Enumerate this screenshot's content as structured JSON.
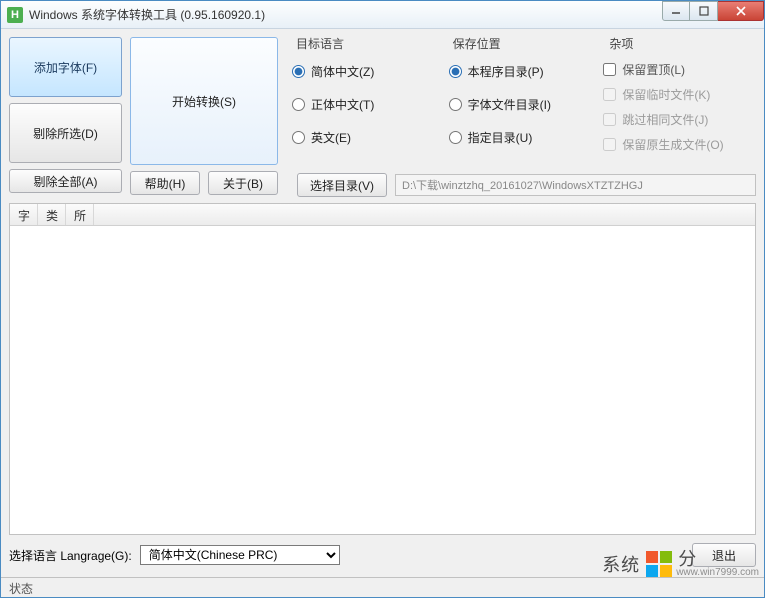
{
  "window": {
    "icon_letter": "H",
    "title": "Windows 系统字体转换工具 (0.95.160920.1)"
  },
  "left_buttons": {
    "add": "添加字体(F)",
    "remove_selected": "剔除所选(D)",
    "remove_all": "剔除全部(A)"
  },
  "main_button": "开始转换(S)",
  "help_button": "帮助(H)",
  "about_button": "关于(B)",
  "select_dir_button": "选择目录(V)",
  "path_value": "D:\\下载\\winztzhq_20161027\\WindowsXTZTZHGJ",
  "groups": {
    "target_lang": {
      "legend": "目标语言",
      "opts": [
        "简体中文(Z)",
        "正体中文(T)",
        "英文(E)"
      ],
      "selected": 0
    },
    "save_location": {
      "legend": "保存位置",
      "opts": [
        "本程序目录(P)",
        "字体文件目录(I)",
        "指定目录(U)"
      ],
      "selected": 0
    },
    "misc": {
      "legend": "杂项",
      "opts": [
        "保留置顶(L)",
        "保留临时文件(K)",
        "跳过相同文件(J)",
        "保留原生成文件(O)"
      ]
    }
  },
  "table": {
    "headers": [
      "字",
      "类",
      "所"
    ]
  },
  "bottom": {
    "lang_label": "选择语言 Langrage(G):",
    "lang_selected": "简体中文(Chinese PRC)",
    "exit": "退出"
  },
  "statusbar": "状态",
  "watermark": {
    "cn": "系统",
    "cn2": "分",
    "url": "www.win7999.com"
  }
}
